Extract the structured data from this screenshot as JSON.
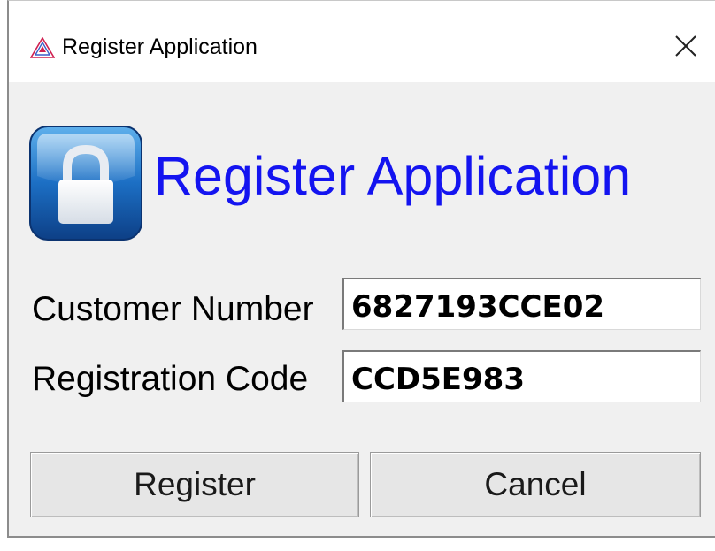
{
  "window": {
    "title": "Register Application",
    "icons": {
      "app": "triangle-logo-icon",
      "close": "close-icon"
    }
  },
  "header": {
    "icon": "padlock-icon",
    "title": "Register Application",
    "title_color": "#1414f0"
  },
  "form": {
    "customer_number": {
      "label": "Customer Number",
      "value": "6827193CCE02"
    },
    "registration_code": {
      "label": "Registration Code",
      "value": "CCD5E983"
    }
  },
  "buttons": {
    "register": "Register",
    "cancel": "Cancel"
  }
}
